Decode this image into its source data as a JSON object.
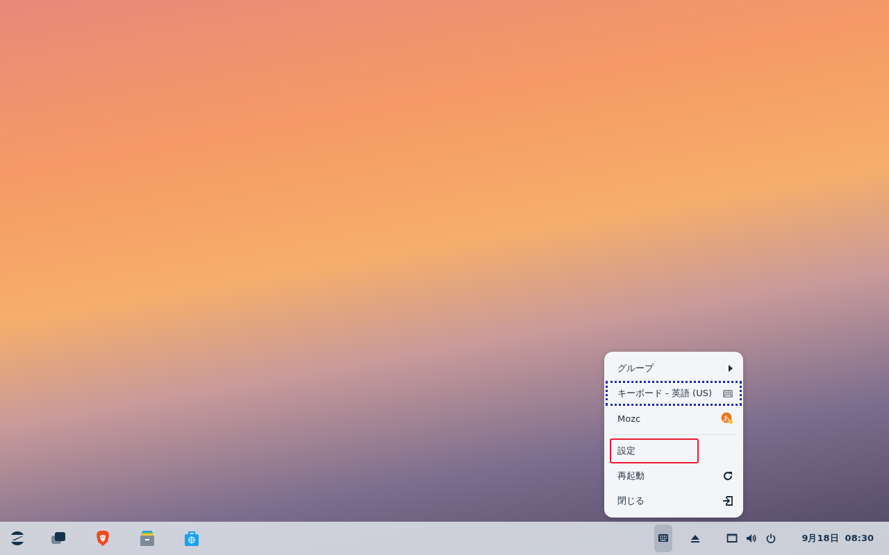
{
  "menu": {
    "items": [
      {
        "kind": "submenu",
        "label": "グループ",
        "focused": false,
        "highlighted": false
      },
      {
        "kind": "keyboard",
        "label": "キーボード - 英語 (US)",
        "focused": true,
        "highlighted": false
      },
      {
        "kind": "mozc",
        "label": "Mozc",
        "icon_text": "あ",
        "focused": false,
        "highlighted": false
      },
      {
        "kind": "separator"
      },
      {
        "kind": "plain",
        "label": "設定",
        "focused": false,
        "highlighted": true
      },
      {
        "kind": "restart",
        "label": "再起動",
        "focused": false,
        "highlighted": false
      },
      {
        "kind": "exit",
        "label": "閉じる",
        "focused": false,
        "highlighted": false
      }
    ]
  },
  "taskbar": {
    "apps": [
      {
        "kind": "zorin"
      },
      {
        "kind": "windows"
      },
      {
        "kind": "lion"
      },
      {
        "kind": "files"
      },
      {
        "kind": "store"
      }
    ],
    "tray": [
      {
        "kind": "keyboard",
        "selected": true
      },
      {
        "kind": "eject",
        "selected": false
      },
      {
        "kind": "network",
        "selected": false
      },
      {
        "kind": "volume",
        "selected": false
      },
      {
        "kind": "power",
        "selected": false
      }
    ],
    "clock": "9月18日  08:30"
  }
}
